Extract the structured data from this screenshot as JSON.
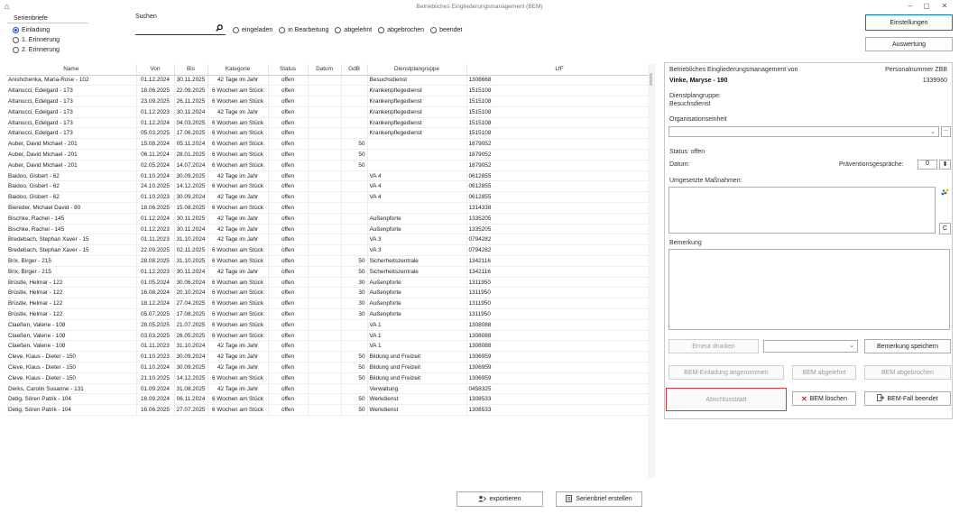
{
  "window": {
    "title": "Betriebliches Eingliederungsmanagement (BEM)",
    "app_icon": "⌂",
    "min": "–",
    "max": "▢",
    "close": "✕"
  },
  "serienbriefe": {
    "label": "Serienbriefe",
    "options": [
      {
        "label": "Einladung",
        "selected": true
      },
      {
        "label": "1. Erinnerung",
        "selected": false
      },
      {
        "label": "2. Erinnerung",
        "selected": false
      }
    ]
  },
  "search": {
    "label": "Suchen",
    "value": "",
    "icon": "search-icon"
  },
  "status_filters": [
    "eingeladen",
    "in Bearbeitung",
    "abgelehnt",
    "abgebrochen",
    "beendet"
  ],
  "buttons": {
    "einstellungen": "Einstellungen",
    "auswertung": "Auswertung",
    "exportieren": "exportieren",
    "serienbrief": "Serienbrief erstellen"
  },
  "table": {
    "columns": [
      "Name",
      "Von",
      "Bis",
      "Kategorie",
      "Status",
      "Datum",
      "GdB",
      "Dienstplangruppe",
      "LfF"
    ],
    "rows": [
      [
        "Anishchenka, Maria-Rose - 102",
        "01.12.2024",
        "30.11.2025",
        "42 Tage im Jahr",
        "offen",
        "",
        "",
        "Besuchsdienst",
        "1308668"
      ],
      [
        "Attanucci, Edelgard - 173",
        "18.06.2025",
        "22.09.2025",
        "6 Wochen am Stück",
        "offen",
        "",
        "",
        "Krankenpflegedienst",
        "1515108"
      ],
      [
        "Attanucci, Edelgard - 173",
        "23.09.2025",
        "26.11.2025",
        "6 Wochen am Stück",
        "offen",
        "",
        "",
        "Krankenpflegedienst",
        "1515108"
      ],
      [
        "Attanucci, Edelgard - 173",
        "01.12.2023",
        "30.11.2024",
        "42 Tage im Jahr",
        "offen",
        "",
        "",
        "Krankenpflegedienst",
        "1515108"
      ],
      [
        "Attanucci, Edelgard - 173",
        "01.12.2024",
        "04.03.2025",
        "6 Wochen am Stück",
        "offen",
        "",
        "",
        "Krankenpflegedienst",
        "1515108"
      ],
      [
        "Attanucci, Edelgard - 173",
        "05.03.2025",
        "17.06.2025",
        "6 Wochen am Stück",
        "offen",
        "",
        "",
        "Krankenpflegedienst",
        "1515108"
      ],
      [
        "Auber, David Michael - 201",
        "15.08.2024",
        "05.11.2024",
        "6 Wochen am Stück",
        "offen",
        "",
        "50",
        "",
        "1879052"
      ],
      [
        "Auber, David Michael - 201",
        "06.11.2024",
        "28.01.2025",
        "6 Wochen am Stück",
        "offen",
        "",
        "50",
        "",
        "1879052"
      ],
      [
        "Auber, David Michael - 201",
        "02.05.2024",
        "14.07.2024",
        "6 Wochen am Stück",
        "offen",
        "",
        "50",
        "",
        "1879052"
      ],
      [
        "Baidoo, Gisbert - 62",
        "01.10.2024",
        "30.09.2025",
        "42 Tage im Jahr",
        "offen",
        "",
        "",
        "VA 4",
        "0612855"
      ],
      [
        "Baidoo, Gisbert - 62",
        "24.10.2025",
        "14.12.2025",
        "6 Wochen am Stück",
        "offen",
        "",
        "",
        "VA 4",
        "0612855"
      ],
      [
        "Baidoo, Gisbert - 62",
        "01.10.2023",
        "30.09.2024",
        "42 Tage im Jahr",
        "offen",
        "",
        "",
        "VA 4",
        "0612855"
      ],
      [
        "Biereder, Michael David - 80",
        "18.06.2025",
        "15.08.2025",
        "6 Wochen am Stück",
        "offen",
        "",
        "",
        "",
        "1314338"
      ],
      [
        "Bischke, Rachel - 145",
        "01.12.2024",
        "30.11.2025",
        "42 Tage im Jahr",
        "offen",
        "",
        "",
        "Außenpforte",
        "1335205"
      ],
      [
        "Bischke, Rachel - 145",
        "01.12.2023",
        "30.11.2024",
        "42 Tage im Jahr",
        "offen",
        "",
        "",
        "Außenpforte",
        "1335205"
      ],
      [
        "Bredebach, Stephan Xaver - 15",
        "01.11.2023",
        "31.10.2024",
        "42 Tage im Jahr",
        "offen",
        "",
        "",
        "VA 3",
        "0794282"
      ],
      [
        "Bredebach, Stephan Xaver - 15",
        "22.09.2025",
        "02.11.2025",
        "6 Wochen am Stück",
        "offen",
        "",
        "",
        "VA 3",
        "0794282"
      ],
      [
        "Brix, Birger - 215",
        "28.08.2025",
        "31.10.2025",
        "6 Wochen am Stück",
        "offen",
        "",
        "50",
        "Sicherheitszentrale",
        "1342116"
      ],
      [
        "Brix, Birger - 215",
        "01.12.2023",
        "30.11.2024",
        "42 Tage im Jahr",
        "offen",
        "",
        "50",
        "Sicherheitszentrale",
        "1342116"
      ],
      [
        "Brüstle, Helmar - 122",
        "01.05.2024",
        "30.06.2024",
        "6 Wochen am Stück",
        "offen",
        "",
        "30",
        "Außenpforte",
        "1311950"
      ],
      [
        "Brüstle, Helmar - 122",
        "16.08.2024",
        "20.10.2024",
        "6 Wochen am Stück",
        "offen",
        "",
        "30",
        "Außenpforte",
        "1311950"
      ],
      [
        "Brüstle, Helmar - 122",
        "18.12.2024",
        "27.04.2025",
        "6 Wochen am Stück",
        "offen",
        "",
        "30",
        "Außenpforte",
        "1311950"
      ],
      [
        "Brüstle, Helmar - 122",
        "05.07.2025",
        "17.08.2025",
        "6 Wochen am Stück",
        "offen",
        "",
        "30",
        "Außenpforte",
        "1311950"
      ],
      [
        "Claeßen, Valerie - 108",
        "28.05.2025",
        "21.07.2025",
        "6 Wochen am Stück",
        "offen",
        "",
        "",
        "VA 1",
        "1308088"
      ],
      [
        "Claeßen, Valerie - 108",
        "03.03.2025",
        "26.05.2025",
        "6 Wochen am Stück",
        "offen",
        "",
        "",
        "VA 1",
        "1308088"
      ],
      [
        "Claeßen, Valerie - 108",
        "01.11.2023",
        "31.10.2024",
        "42 Tage im Jahr",
        "offen",
        "",
        "",
        "VA 1",
        "1308088"
      ],
      [
        "Cleve, Klaus - Dieter - 150",
        "01.10.2023",
        "30.09.2024",
        "42 Tage im Jahr",
        "offen",
        "",
        "50",
        "Bildung und Freizeit",
        "1306959"
      ],
      [
        "Cleve, Klaus - Dieter - 150",
        "01.10.2024",
        "30.09.2025",
        "42 Tage im Jahr",
        "offen",
        "",
        "50",
        "Bildung und Freizeit",
        "1306959"
      ],
      [
        "Cleve, Klaus - Dieter - 150",
        "21.10.2025",
        "14.12.2025",
        "6 Wochen am Stück",
        "offen",
        "",
        "50",
        "Bildung und Freizeit",
        "1306959"
      ],
      [
        "Derks, Carolin Susanne - 131",
        "01.09.2024",
        "31.08.2025",
        "42 Tage im Jahr",
        "offen",
        "",
        "",
        "Verwaltung",
        "0458325"
      ],
      [
        "Detig, Sören Patrik - 104",
        "16.09.2024",
        "06.11.2024",
        "6 Wochen am Stück",
        "offen",
        "",
        "50",
        "Werkdienst",
        "1308533"
      ],
      [
        "Detig, Sören Patrik - 104",
        "16.06.2025",
        "27.07.2025",
        "6 Wochen am Stück",
        "offen",
        "",
        "50",
        "Werkdienst",
        "1308533"
      ]
    ]
  },
  "details": {
    "header_left": "Betriebliches Eingliederungsmanagement von",
    "header_right": "Personalnummer ZBB",
    "person_name": "Vinke, Maryse - 190",
    "personal_nr": "1339960",
    "dienstplangruppe_label": "Dienstplangruppe:",
    "dienstplangruppe_value": "Besuchsdienst",
    "org_label": "Organisationseinheit",
    "org_value": "",
    "org_more": "...",
    "status": "Status: offen",
    "datum_label": "Datum:",
    "praevention_label": "Präventionsgespräche:",
    "praevention_value": "0",
    "massnahmen_label": "Umgesetzte Maßnahmen:",
    "c_button": "C",
    "bemerkung_label": "Bemerkung",
    "btn_erneut": "Erneut drucken",
    "btn_bemerkung_speichern": "Bemerkung speichern",
    "btn_einladung_angenommen": "BEM-Einladung angenommen",
    "btn_abgelehnt": "BEM abgelehnt",
    "btn_abgebrochen": "BEM abgebrochen",
    "btn_abschlussblatt": "Abschlussblatt",
    "btn_loeschen": "BEM löschen",
    "btn_beendet": "BEM-Fall beendet"
  },
  "colors": {
    "accent": "#0078d4",
    "radio_selected": "#1a56b0",
    "highlight_border": "#d9363e",
    "delete_icon": "#c62828"
  }
}
